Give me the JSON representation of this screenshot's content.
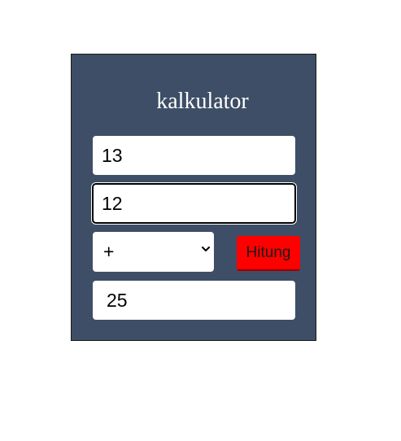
{
  "calculator": {
    "title": "kalkulator",
    "first_number": "13",
    "second_number": "12",
    "operator": {
      "selected": "+"
    },
    "submit_label": "Hitung",
    "result": "25"
  },
  "colors": {
    "panel_background": "#3d4e66",
    "button_background": "#ff0000",
    "field_background": "#ffffff",
    "title_text": "#ffffff"
  },
  "icons": {
    "select_arrow": "chevron-down-icon"
  }
}
